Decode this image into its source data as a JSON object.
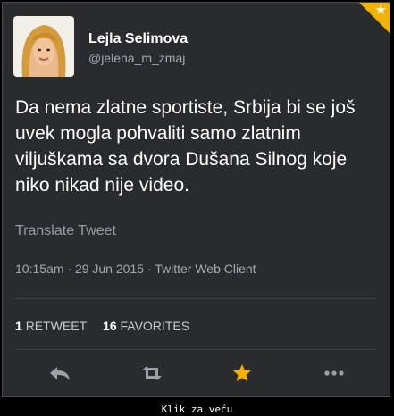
{
  "user": {
    "display_name": "Lejla Selimova",
    "handle": "@jelena_m_zmaj"
  },
  "tweet": {
    "text": "Da nema zlatne sportiste, Srbija bi se još uvek mogla pohvaliti samo zlatnim viljuškama sa dvora Dušana Silnog koje niko nikad nije video.",
    "translate_label": "Translate Tweet",
    "time": "10:15am",
    "date": "29 Jun 2015",
    "client": "Twitter Web Client",
    "separator": " · "
  },
  "stats": {
    "retweets_count": "1",
    "retweets_label": "RETWEET",
    "favorites_count": "16",
    "favorites_label": "FAVORITES"
  },
  "actions": [
    {
      "name": "reply-icon"
    },
    {
      "name": "retweet-icon"
    },
    {
      "name": "favorite-star-icon"
    },
    {
      "name": "more-dots-icon"
    }
  ],
  "caption": "Klik za veću",
  "colors": {
    "background": "#2a2b2f",
    "favorite_star": "#f2b200",
    "text": "#ffffff",
    "muted": "#a8a9ae"
  }
}
